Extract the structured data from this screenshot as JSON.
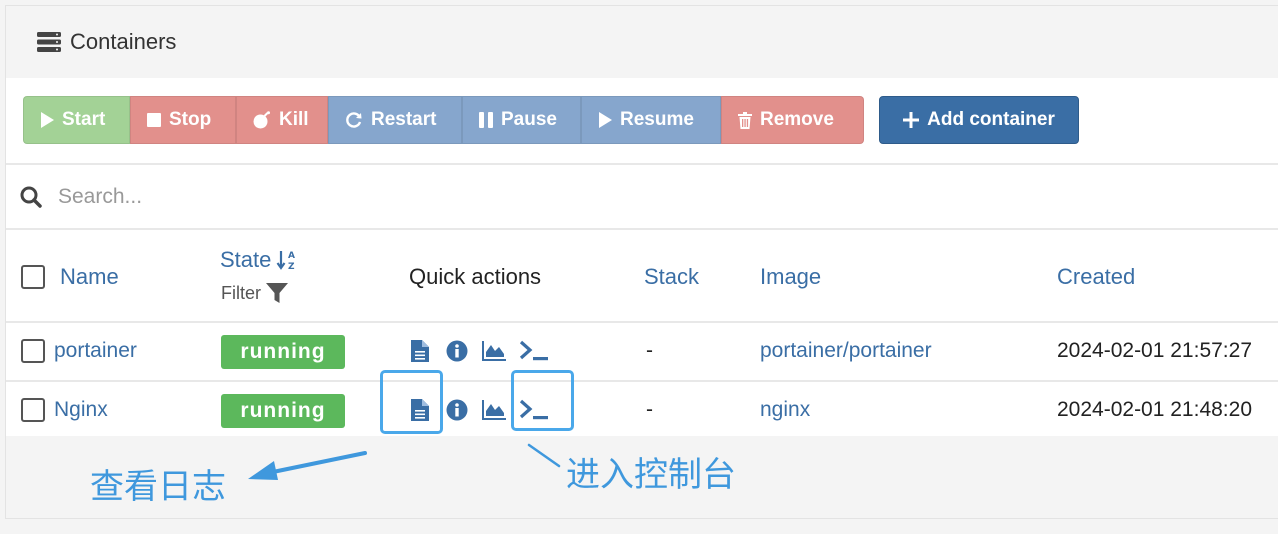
{
  "panel": {
    "title": "Containers",
    "icon": "server-icon"
  },
  "toolbar": {
    "start": "Start",
    "stop": "Stop",
    "kill": "Kill",
    "restart": "Restart",
    "pause": "Pause",
    "resume": "Resume",
    "remove": "Remove",
    "add": "Add container"
  },
  "search": {
    "placeholder": "Search..."
  },
  "table": {
    "columns": {
      "name": "Name",
      "state": "State",
      "state_filter": "Filter",
      "quick_actions": "Quick actions",
      "stack": "Stack",
      "image": "Image",
      "created": "Created"
    },
    "rows": [
      {
        "name": "portainer",
        "state": "running",
        "stack": "-",
        "image": "portainer/portainer",
        "created": "2024-02-01 21:57:27"
      },
      {
        "name": "Nginx",
        "state": "running",
        "stack": "-",
        "image": "nginx",
        "created": "2024-02-01 21:48:20"
      }
    ]
  },
  "annotations": {
    "logs": "查看日志",
    "console": "进入控制台"
  },
  "colors": {
    "accent": "#3a6ea5",
    "running": "#5cb85c",
    "annotation": "#4aa8ea"
  }
}
